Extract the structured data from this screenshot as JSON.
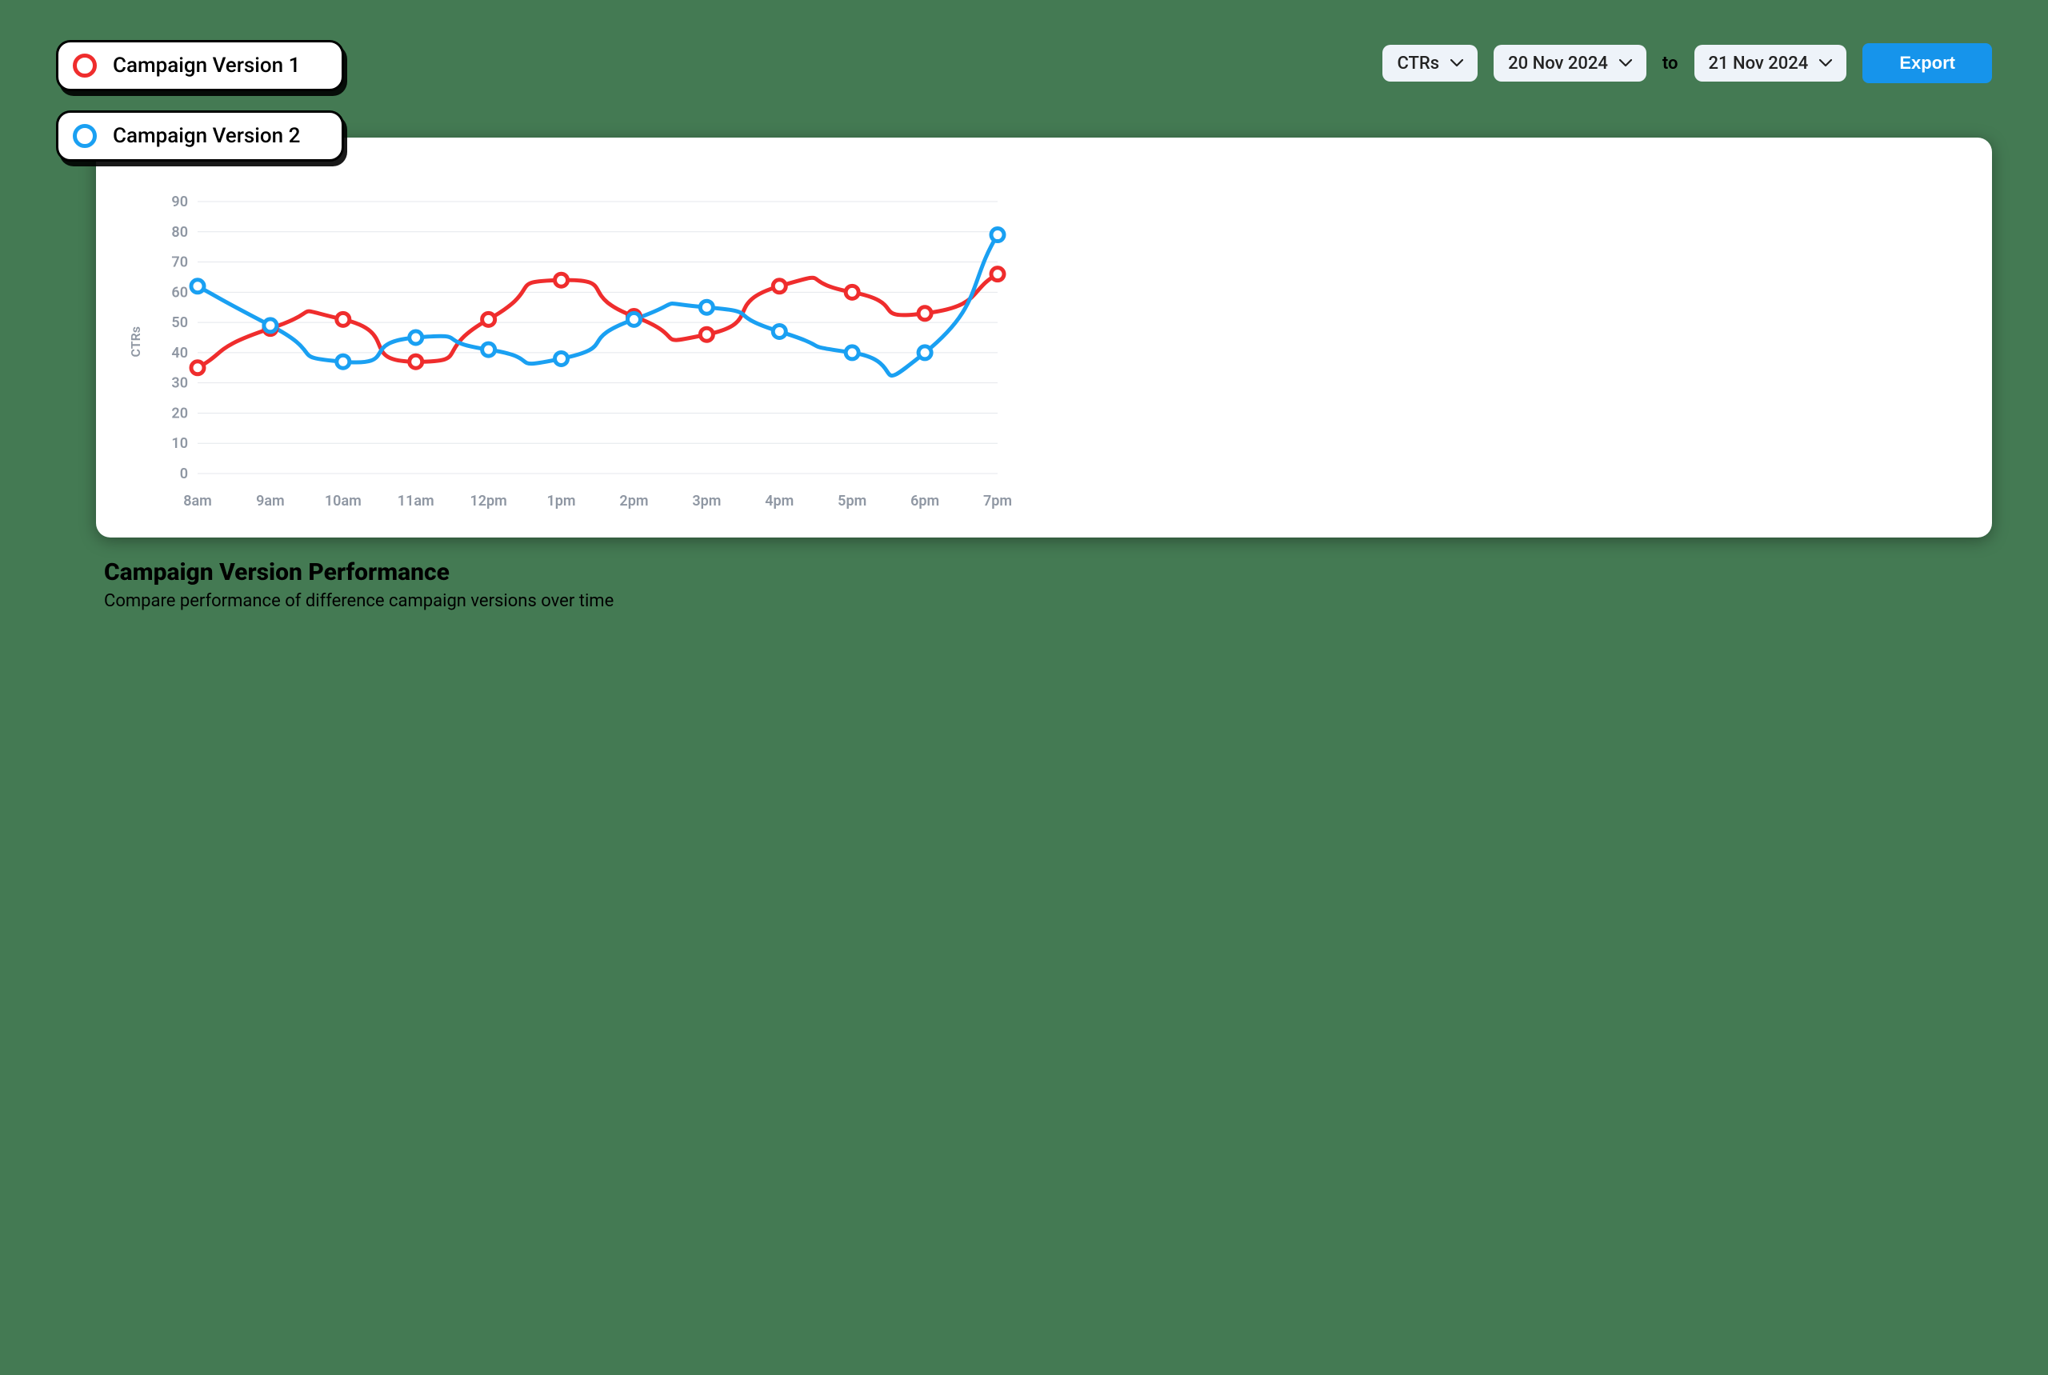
{
  "legend": {
    "items": [
      {
        "label": "Campaign Version 1",
        "color": "#ef2d2d"
      },
      {
        "label": "Campaign Version 2",
        "color": "#1aa0f2"
      }
    ]
  },
  "controls": {
    "metric_select": "CTRs",
    "date_from": "20 Nov 2024",
    "to_label": "to",
    "date_to": "21 Nov 2024",
    "export_label": "Export"
  },
  "caption": {
    "title": "Campaign Version Performance",
    "subtitle": "Compare performance of difference campaign versions over time"
  },
  "chart_data": {
    "type": "line",
    "ylabel": "CTRs",
    "xlabel": "",
    "ylim": [
      0,
      90
    ],
    "y_ticks": [
      0,
      10,
      20,
      30,
      40,
      50,
      60,
      70,
      80,
      90
    ],
    "categories": [
      "8am",
      "9am",
      "10am",
      "11am",
      "12pm",
      "1pm",
      "2pm",
      "3pm",
      "4pm",
      "5pm",
      "6pm",
      "7pm"
    ],
    "series": [
      {
        "name": "Campaign Version 1",
        "color": "#ef2d2d",
        "values": [
          35,
          48,
          51,
          37,
          51,
          64,
          52,
          46,
          62,
          60,
          53,
          66
        ]
      },
      {
        "name": "Campaign Version 2",
        "color": "#1aa0f2",
        "values": [
          62,
          49,
          37,
          45,
          41,
          38,
          51,
          55,
          47,
          40,
          40,
          79
        ]
      }
    ]
  }
}
